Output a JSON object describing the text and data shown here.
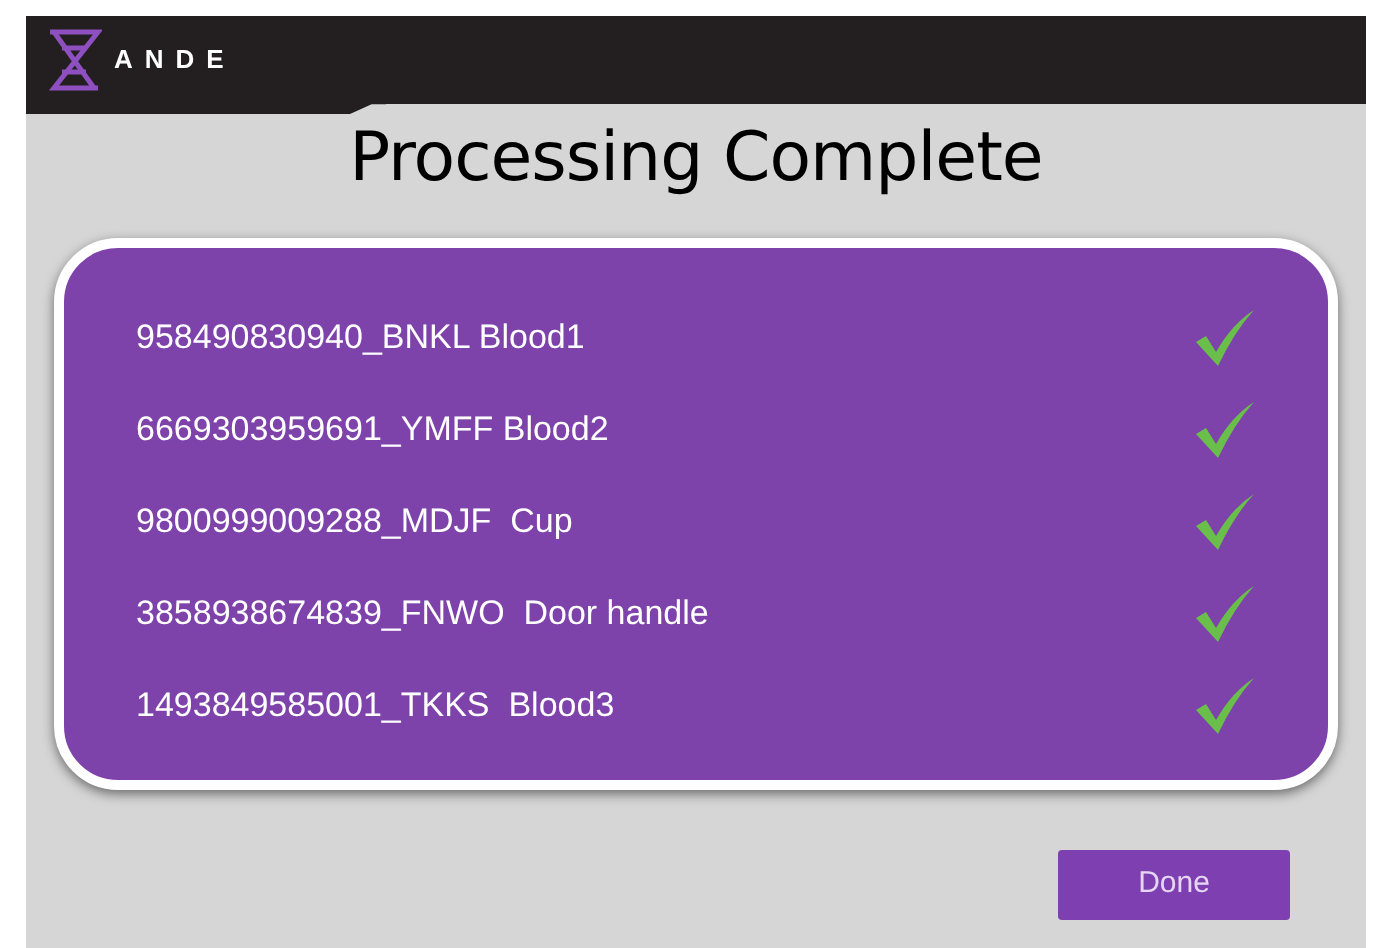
{
  "header": {
    "logo_text": "ANDE"
  },
  "title": "Processing Complete",
  "samples": [
    {
      "label": "958490830940_BNKL Blood1",
      "checked": true
    },
    {
      "label": "6669303959691_YMFF Blood2",
      "checked": true
    },
    {
      "label": "9800999009288_MDJF  Cup",
      "checked": true
    },
    {
      "label": "3858938674839_FNWO  Door handle",
      "checked": true
    },
    {
      "label": "1493849585001_TKKS  Blood3",
      "checked": true
    }
  ],
  "buttons": [
    "Done"
  ]
}
